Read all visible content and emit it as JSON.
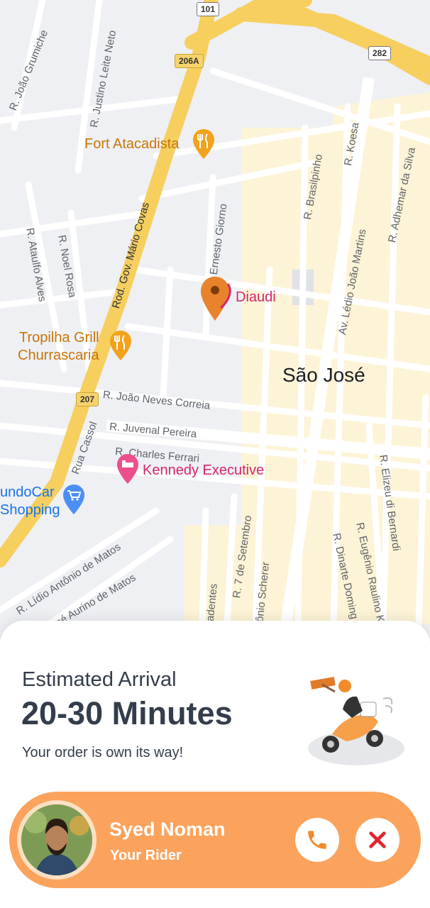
{
  "map": {
    "pois": {
      "fort_atacadista": "Fort Atacadista",
      "diaudi": "Diaudi",
      "tropilha_line1": "Tropilha Grill",
      "tropilha_line2": "Churrascaria",
      "kennedy": "Kennedy Executive",
      "mundocar_line1": "undoCar",
      "mundocar_line2": "Shopping"
    },
    "city": "São José",
    "shields": {
      "s101": "101",
      "s282": "282",
      "s206a": "206A",
      "s207": "207"
    },
    "streets": {
      "joao_grumiche": "R. João Grumiche",
      "justino": "R. Justino Leite Neto",
      "mario_covas": "Rod. Gov. Mário Covas",
      "ernesto": "R. Ernesto Giorno",
      "brasilpinho": "R. Brasilpinho",
      "koesa": "R. Koesa",
      "adhemar": "R. Adhemar da Silva",
      "ataulfo": "R. Ataulfo Alves",
      "noel": "R. Noel Rosa",
      "ledio": "Av. Lédio João Martins",
      "joao_neves": "R. João Neves Correia",
      "juvenal": "R. Juvenal Pereira",
      "charles": "R. Charles Ferrari",
      "cassol": "Rua Cassol",
      "elizeu": "R. Elizeu di Bernardi",
      "lidio": "R. Lídio Antônio de Matos",
      "aurino": "José Aurino de Matos",
      "sete_setembro": "R. 7 de Setembro",
      "tonio_scherer": "tônio Scherer",
      "radentes": "radentes",
      "dinarte": "R. Dinarte Doming",
      "eugenio": "R. Eugênio Raulino K"
    },
    "colors": {
      "road": "#ffffff",
      "highway": "#f6cf5f",
      "commercial": "#fdf3d6",
      "background": "#eef0f3",
      "pin": "#e8832c"
    }
  },
  "delivery": {
    "eta_label": "Estimated Arrival",
    "eta_value": "20-30 Minutes",
    "note": "Your order is own its way!"
  },
  "rider": {
    "name": "Syed Noman",
    "role": "Your Rider",
    "card_color": "#fba35d"
  },
  "icons": {
    "call": "phone-icon",
    "cancel": "close-icon",
    "restaurant": "fork-knife-icon",
    "hotel": "bed-icon",
    "shopping": "cart-icon",
    "pin": "map-pin-icon"
  }
}
